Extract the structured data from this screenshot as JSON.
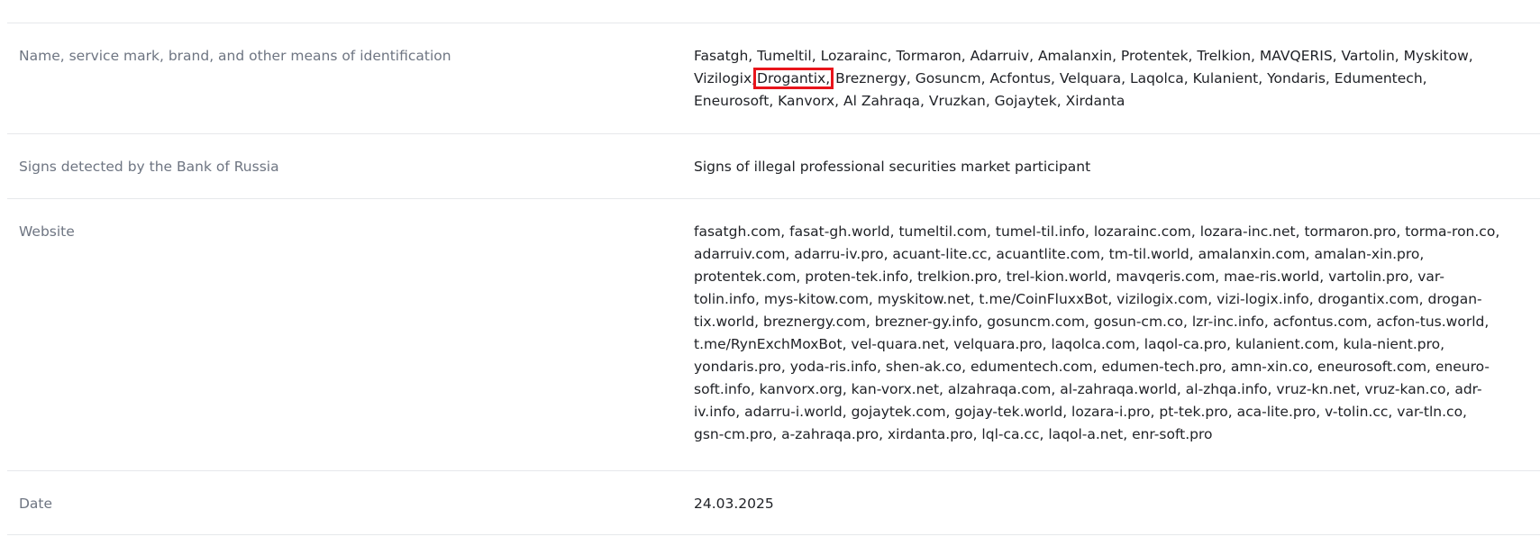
{
  "rows": {
    "name": {
      "label": "Name, service mark, brand, and other means of identification",
      "lines": [
        "Fasatgh, Tumeltil, Lozarainc, Tormaron, Adarruiv, Amalanxin, Protentek, Trelkion, MAVQERIS, Vartolin, Myskitow,",
        "Eneurosoft, Kanvorx, Al Zahraqa, Vruzkan, Gojaytek, Xirdanta"
      ],
      "line2_before": "Vizilogix,",
      "line2_highlight": "Drogantix,",
      "line2_after": "Breznergy, Gosuncm, Acfontus, Velquara, Laqolca, Kulanient, Yondaris, Edumentech,"
    },
    "signs": {
      "label": "Signs detected by the Bank of Russia",
      "value": "Signs of illegal professional securities market participant"
    },
    "website": {
      "label": "Website",
      "lines": [
        "fasatgh.com, fasat-gh.world, tumeltil.com, tumel-til.info, lozarainc.com, lozara-inc.net, tormaron.pro, torma-ron.co,",
        "adarruiv.com, adarru-iv.pro, acuant-lite.cc, acuantlite.com, tm-til.world, amalanxin.com, amalan-xin.pro,",
        "protentek.com, proten-tek.info, trelkion.pro, trel-kion.world, mavqeris.com, mae-ris.world, vartolin.pro, var-",
        "tolin.info, mys-kitow.com, myskitow.net, t.me/CoinFluxxBot, vizilogix.com, vizi-logix.info, drogantix.com, drogan-",
        "tix.world, breznergy.com, brezner-gy.info, gosuncm.com, gosun-cm.co, lzr-inc.info, acfontus.com, acfon-tus.world,",
        "t.me/RynExchMoxBot, vel-quara.net, velquara.pro, laqolca.com, laqol-ca.pro, kulanient.com, kula-nient.pro,",
        "yondaris.pro, yoda-ris.info, shen-ak.co, edumentech.com, edumen-tech.pro, amn-xin.co, eneurosoft.com, eneuro-",
        "soft.info, kanvorx.org, kan-vorx.net, alzahraqa.com, al-zahraqa.world, al-zhqa.info, vruz-kn.net, vruz-kan.co, adr-",
        "iv.info, adarru-i.world, gojaytek.com, gojay-tek.world, lozara-i.pro, pt-tek.pro, aca-lite.pro, v-tolin.cc, var-tln.co,",
        "gsn-cm.pro, a-zahraqa.pro, xirdanta.pro, lql-ca.cc, laqol-a.net, enr-soft.pro"
      ]
    },
    "date": {
      "label": "Date",
      "value": "24.03.2025"
    }
  },
  "colors": {
    "highlight": "#e8141b",
    "label": "#6e7582",
    "value": "#202227",
    "divider": "#e6e8eb"
  }
}
